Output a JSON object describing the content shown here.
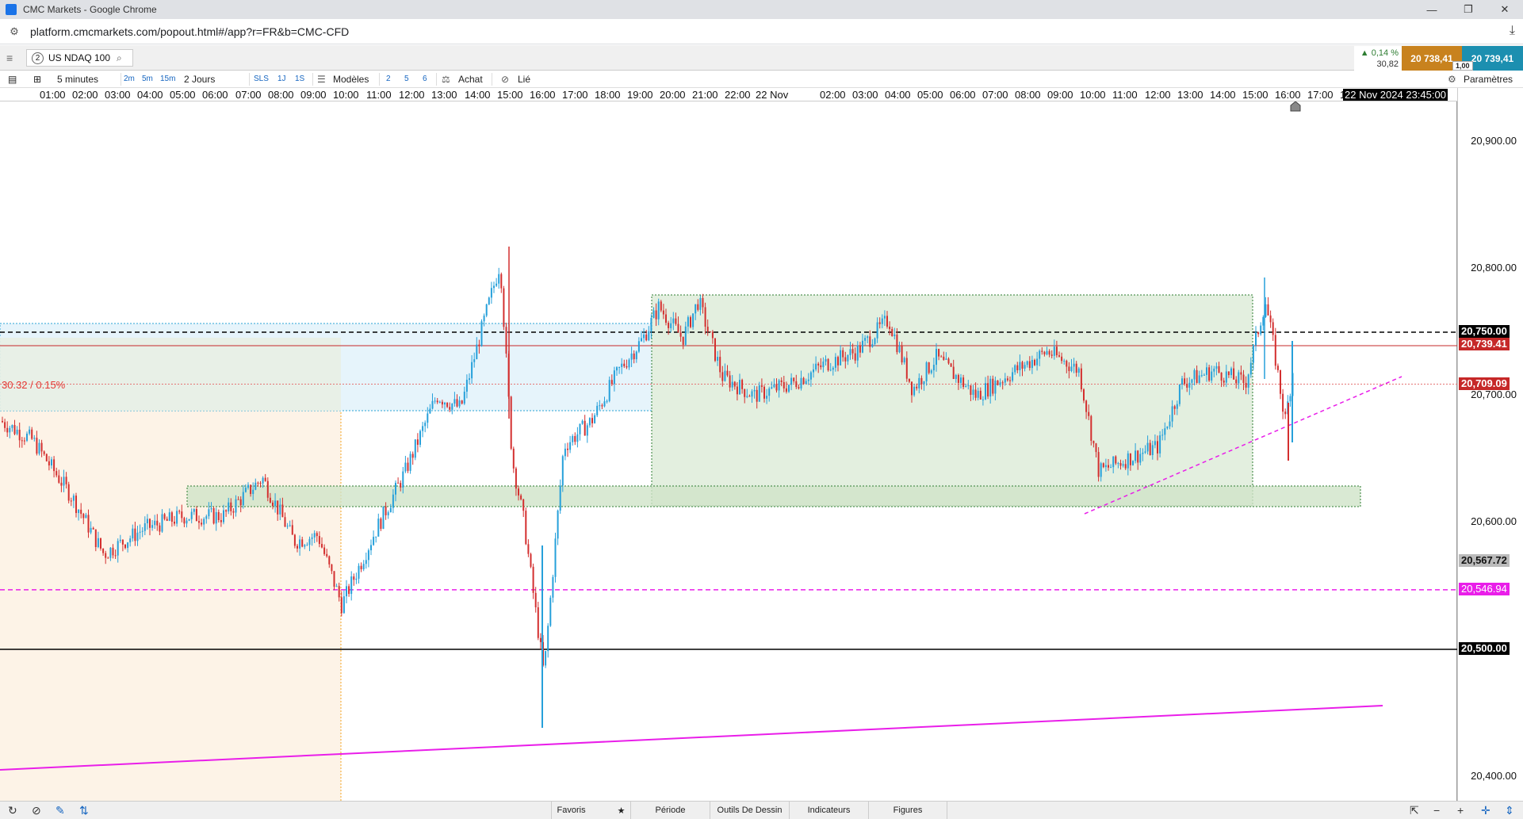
{
  "window": {
    "title": "CMC Markets - Google Chrome",
    "minimize": "—",
    "restore": "❐",
    "close": "✕"
  },
  "browser": {
    "url": "platform.cmcmarkets.com/popout.html#/app?r=FR&b=CMC-CFD"
  },
  "instrument": {
    "index": "2",
    "name": "US NDAQ 100"
  },
  "quote": {
    "change_pct": "▲ 0,14 %",
    "change_abs": "30,82",
    "sell": "20 738,41",
    "buy": "20 739,41",
    "spread": "1,00"
  },
  "toolbar": {
    "interval": "5 minutes",
    "quick_intervals": [
      "2m",
      "5m",
      "15m"
    ],
    "period": "2 Jours",
    "quick_periods": [
      "SLS",
      "1J",
      "1S"
    ],
    "templates": "Modèles",
    "template_slots": [
      "2",
      "5",
      "6"
    ],
    "buy": "Achat",
    "linked": "Lié",
    "settings": "Paramètres"
  },
  "time_axis": {
    "labels": [
      "01:00",
      "02:00",
      "03:00",
      "04:00",
      "05:00",
      "06:00",
      "07:00",
      "08:00",
      "09:00",
      "10:00",
      "11:00",
      "12:00",
      "13:00",
      "14:00",
      "15:00",
      "16:00",
      "17:00",
      "18:00",
      "19:00",
      "20:00",
      "21:00",
      "22:00",
      "22 Nov",
      "02:00",
      "03:00",
      "04:00",
      "05:00",
      "06:00",
      "07:00",
      "08:00",
      "09:00",
      "10:00",
      "11:00",
      "12:00",
      "13:00",
      "14:00",
      "15:00",
      "16:00",
      "17:00",
      "1"
    ],
    "cursor_label": "22 Nov 2024 23:45:00"
  },
  "price_axis": {
    "ticks": [
      "20,900.00",
      "20,800.00",
      "20,700.00",
      "20,600.00",
      "20,400.00"
    ],
    "labels": {
      "level_20750": "20,750.00",
      "current": "20,739.41",
      "level_20709": "20,709.09",
      "level_20567": "20,567.72",
      "level_20546": "20,546.94",
      "level_20500": "20,500.00"
    }
  },
  "overlay": {
    "measure_label": "30.32 / 0.15%"
  },
  "colors": {
    "up": "#26a0da",
    "down": "#d32f2f",
    "magenta": "#e91ee9",
    "current_price": "#c62828",
    "green_zone": "#2e7d32",
    "blue_zone": "#29a3d6",
    "orange_zone": "#f5a623"
  },
  "bottom": {
    "favorites": "Favoris",
    "period": "Période",
    "drawing_tools": "Outils De Dessin",
    "indicators": "Indicateurs",
    "figures": "Figures"
  }
}
